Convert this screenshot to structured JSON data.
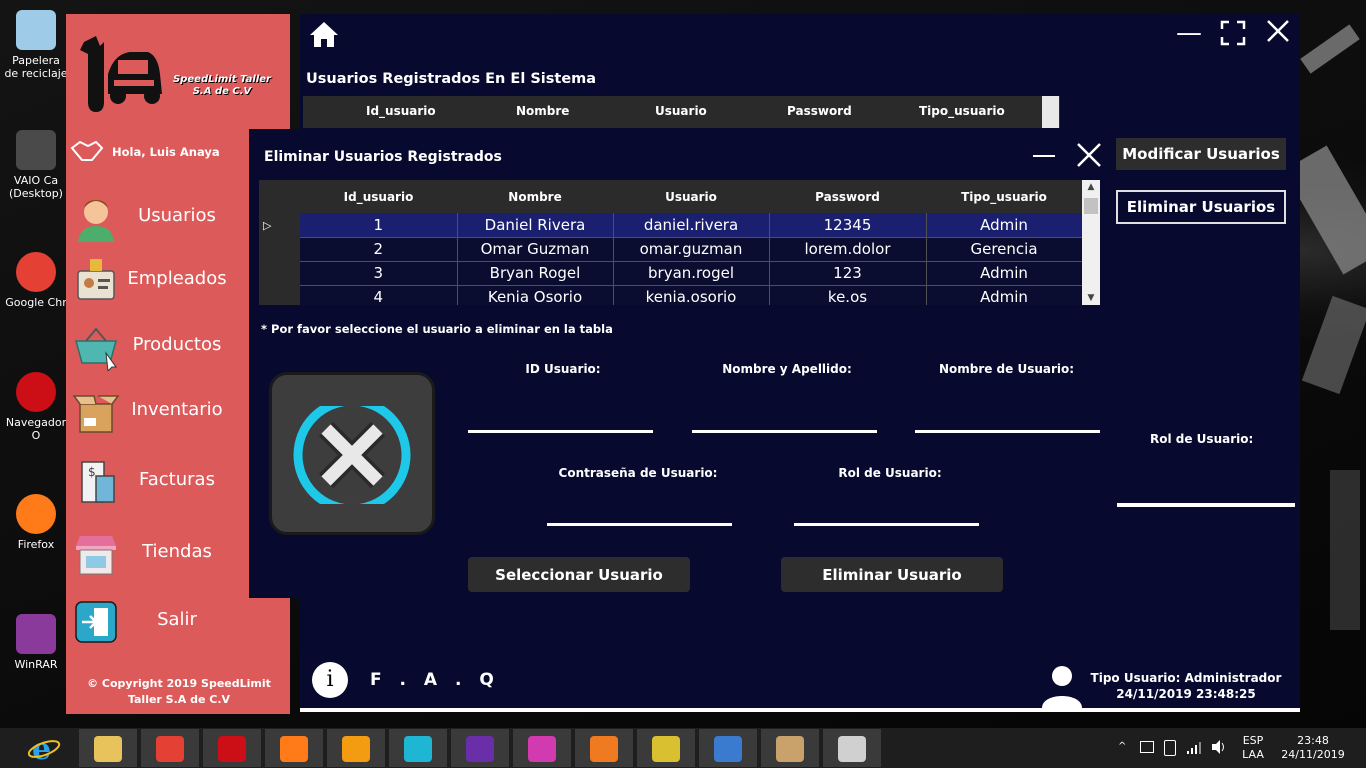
{
  "desktop": {
    "icons": [
      {
        "label": "Papelera de reciclaje",
        "short": "Papelera\nreciclaje",
        "color": "#9ecbe8"
      },
      {
        "label": "VAIO Ca (Desktop)",
        "short": "VAIO Ca\n(Desktop",
        "color": "#4a4a4a"
      },
      {
        "label": "Google Chr",
        "short": "Google Chr",
        "color": "#e44134"
      },
      {
        "label": "Navegador O",
        "short": "Navegador O",
        "color": "#cc0f16"
      },
      {
        "label": "Firefox",
        "short": "Firefox",
        "color": "#ff7a18"
      },
      {
        "label": "WinRAR",
        "short": "WinRAR",
        "color": "#8a3a9a"
      }
    ]
  },
  "main": {
    "title": "Usuarios Registrados En El Sistema",
    "bg_columns": [
      "Id_usuario",
      "Nombre",
      "Usuario",
      "Password",
      "Tipo_usuario"
    ],
    "modify_button": "Modificar Usuarios",
    "delete_button": "Eliminar Usuarios",
    "rol_label": "Rol de Usuario:",
    "faq": "F . A . Q",
    "user_type": "Tipo Usuario: Administrador",
    "datetime": "24/11/2019 23:48:25"
  },
  "sidebar": {
    "logo_text": "SpeedLimit Taller S.A de C.V",
    "greeting": "Hola, Luis Anaya",
    "items": [
      {
        "label": "Usuarios"
      },
      {
        "label": "Empleados"
      },
      {
        "label": "Productos"
      },
      {
        "label": "Inventario"
      },
      {
        "label": "Facturas"
      },
      {
        "label": "Tiendas"
      },
      {
        "label": "Salir"
      }
    ],
    "copyright": "© Copyright 2019 SpeedLimit Taller S.A de C.V"
  },
  "dialog": {
    "title": "Eliminar Usuarios Registrados",
    "columns": [
      "Id_usuario",
      "Nombre",
      "Usuario",
      "Password",
      "Tipo_usuario"
    ],
    "rows": [
      [
        "1",
        "Daniel Rivera",
        "daniel.rivera",
        "12345",
        "Admin"
      ],
      [
        "2",
        "Omar Guzman",
        "omar.guzman",
        "lorem.dolor",
        "Gerencia"
      ],
      [
        "3",
        "Bryan Rogel",
        "bryan.rogel",
        "123",
        "Admin"
      ],
      [
        "4",
        "Kenia Osorio",
        "kenia.osorio",
        "ke.os",
        "Admin"
      ]
    ],
    "selected_row_marker": "▷",
    "hint": "* Por favor seleccione el usuario a eliminar en la tabla",
    "fields": {
      "id": {
        "label": "ID Usuario:",
        "value": ""
      },
      "name": {
        "label": "Nombre y Apellido:",
        "value": ""
      },
      "username": {
        "label": "Nombre de Usuario:",
        "value": ""
      },
      "password": {
        "label": "Contraseña de Usuario:",
        "value": ""
      },
      "role": {
        "label": "Rol de Usuario:",
        "value": ""
      }
    },
    "select_button": "Seleccionar Usuario",
    "delete_button": "Eliminar Usuario"
  },
  "taskbar": {
    "apps": [
      {
        "icon": "file-explorer-icon",
        "color": "#e8c25a"
      },
      {
        "icon": "chrome-icon",
        "color": "#e44134"
      },
      {
        "icon": "opera-icon",
        "color": "#cc0f16"
      },
      {
        "icon": "firefox-icon",
        "color": "#ff7a18"
      },
      {
        "icon": "sublime-icon",
        "color": "#f39c12"
      },
      {
        "icon": "vscode-icon",
        "color": "#1fb6d3"
      },
      {
        "icon": "visual-studio-icon",
        "color": "#6a2ea8"
      },
      {
        "icon": "wamp-icon",
        "color": "#d23ab0"
      },
      {
        "icon": "xampp-icon",
        "color": "#f07a20"
      },
      {
        "icon": "tools-icon",
        "color": "#d9c030"
      },
      {
        "icon": "virtualbox-icon",
        "color": "#3a7bd0"
      },
      {
        "icon": "paint-icon",
        "color": "#c9a26b"
      },
      {
        "icon": "app-plug-icon",
        "color": "#d0d0d0"
      }
    ],
    "lang_top": "ESP",
    "lang_bottom": "LAA",
    "time": "23:48",
    "date": "24/11/2019",
    "tray_up": "^"
  }
}
